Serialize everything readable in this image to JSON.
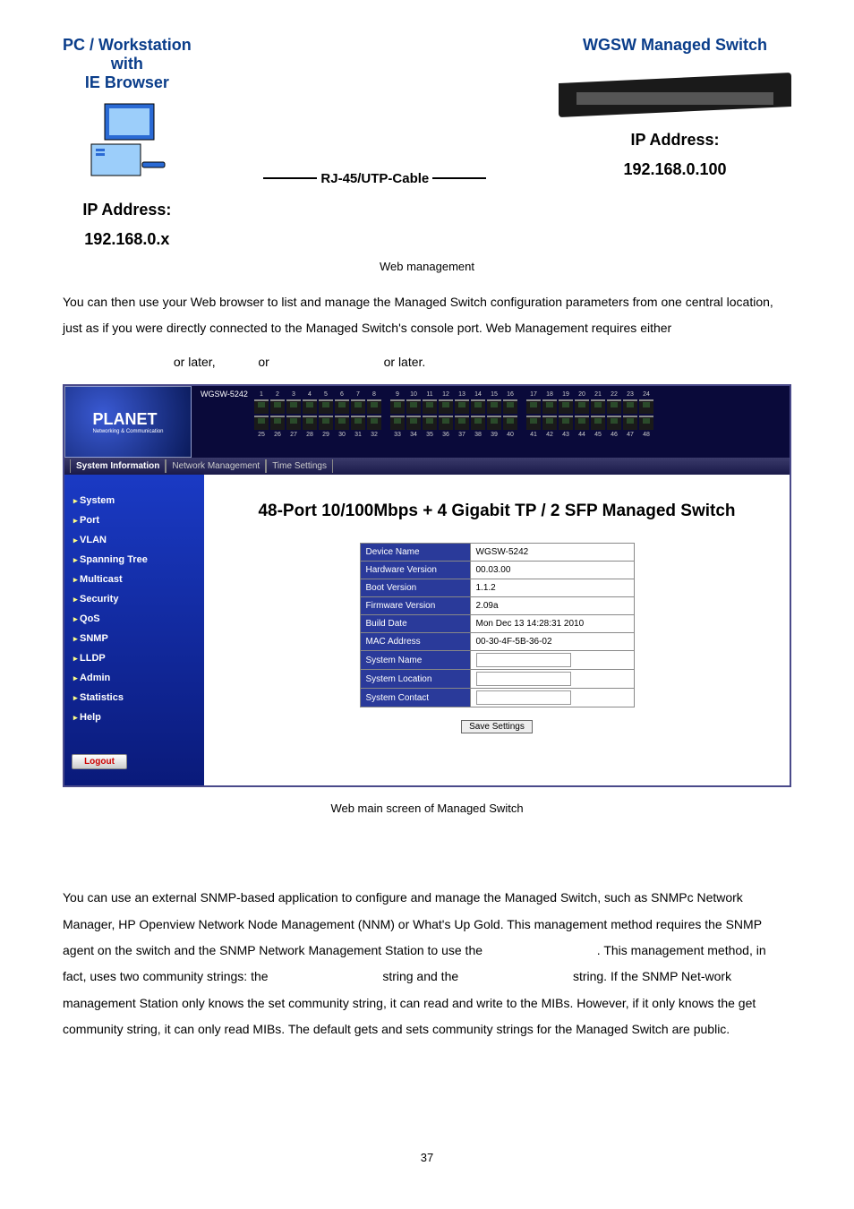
{
  "diagram": {
    "pc_title": "PC / Workstation\nwith\nIE Browser",
    "pc_ip_label": "IP Address:",
    "pc_ip": "192.168.0.x",
    "cable": "RJ-45/UTP-Cable",
    "switch_title": "WGSW Managed Switch",
    "switch_ip_label": "IP Address:",
    "switch_ip": "192.168.0.100"
  },
  "caption1": "Web management",
  "para1a": "You can then use your Web browser to list and manage the Managed Switch configuration parameters from one central location, just as if you were directly connected to the Managed Switch's console port. Web Management requires either",
  "para1b_before": "",
  "para1b_orlater1": " or later,",
  "para1b_or": " or",
  "para1b_orlater2": " or later.",
  "webui": {
    "model": "WGSW-5242",
    "tabs": [
      "System Information",
      "Network Management",
      "Time Settings"
    ],
    "sidebar": [
      "System",
      "Port",
      "VLAN",
      "Spanning Tree",
      "Multicast",
      "Security",
      "QoS",
      "SNMP",
      "LLDP",
      "Admin",
      "Statistics",
      "Help"
    ],
    "logout": "Logout",
    "main_title": "48-Port 10/100Mbps + 4 Gigabit TP / 2 SFP Managed Switch",
    "rows": [
      {
        "k": "Device Name",
        "v": "WGSW-5242"
      },
      {
        "k": "Hardware Version",
        "v": "00.03.00"
      },
      {
        "k": "Boot Version",
        "v": "1.1.2"
      },
      {
        "k": "Firmware Version",
        "v": "2.09a"
      },
      {
        "k": "Build Date",
        "v": "Mon Dec 13 14:28:31 2010"
      },
      {
        "k": "MAC Address",
        "v": "00-30-4F-5B-36-02"
      }
    ],
    "input_rows": [
      {
        "k": "System Name"
      },
      {
        "k": "System Location"
      },
      {
        "k": "System Contact"
      }
    ],
    "save": "Save Settings",
    "logo": "PLANET",
    "logo_sub": "Networking & Communication"
  },
  "caption2": "Web main screen of Managed Switch",
  "para2a": "You can use an external SNMP-based application to configure and manage the Managed Switch, such as SNMPc Network Manager, HP Openview Network Node Management (NNM) or What's Up Gold. This management method requires the SNMP agent on the switch and the SNMP Network Management Station to use the ",
  "para2b": ". This management method, in fact, uses two community strings: the ",
  "para2c": " string and the ",
  "para2d": " string. If the SNMP Net-work management Station only knows the set community string, it can read and write to the MIBs. However, if it only knows the get community string, it can only read MIBs. The default gets and sets community strings for the Managed Switch are public.",
  "page": "37"
}
